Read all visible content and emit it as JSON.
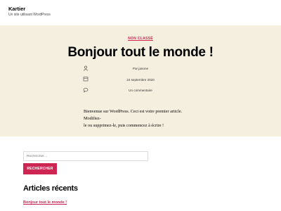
{
  "header": {
    "site_title": "Kartier",
    "site_description": "Un site utilisant WordPress"
  },
  "post": {
    "category": "NON CLASSÉ",
    "title": "Bonjour tout le monde !",
    "meta": {
      "author": "Par janone",
      "date": "24 septembre 2020",
      "comments": "Un commentaire"
    },
    "body_line_1": "Bienvenue sur WordPress. Ceci est votre premier article. Modifiez-",
    "body_line_2": "le ou supprimez-le, puis commencez à écrire !"
  },
  "search": {
    "placeholder": "Rechercher…",
    "button_label": "RECHERCHER"
  },
  "recent_posts": {
    "title": "Articles récents",
    "items": [
      "Bonjour tout le monde !"
    ]
  },
  "colors": {
    "accent": "#cd2653",
    "post_background": "#f5efe0"
  },
  "icons": {
    "author": "user-icon",
    "date": "calendar-icon",
    "comments": "comment-icon"
  }
}
